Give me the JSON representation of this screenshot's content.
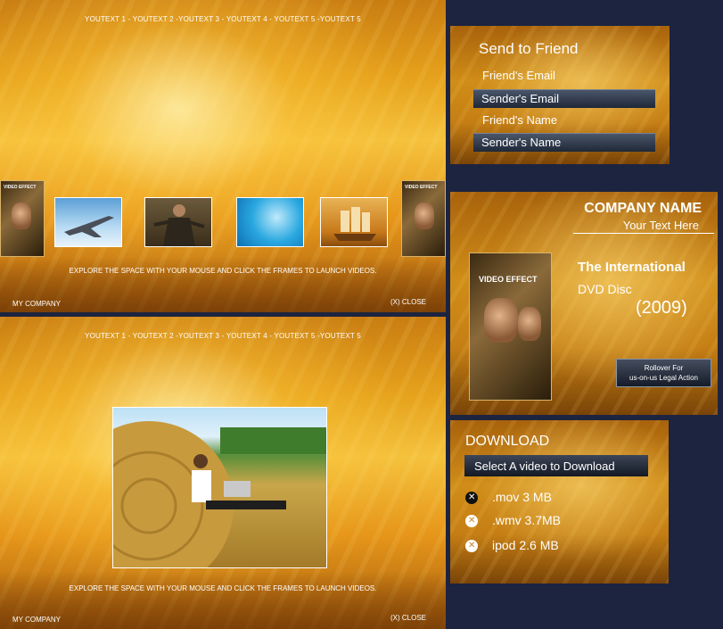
{
  "player_top": {
    "nav": "YOUTEXT 1 - YOUTEXT 2 -YOUTEXT 3 - YOUTEXT 4 - YOUTEXT 5 -YOUTEXT 5",
    "hint": "EXPLORE THE SPACE WITH YOUR MOUSE AND CLICK THE FRAMES TO LAUNCH VIDEOS.",
    "company": "MY COMPANY",
    "close": "(X) CLOSE",
    "dvd_label": "VIDEO EFFECT",
    "thumbnails": [
      "fighter-jet",
      "warrior",
      "blue-water",
      "tall-ship"
    ]
  },
  "player_bottom": {
    "nav": "YOUTEXT 1 - YOUTEXT 2 -YOUTEXT 3 - YOUTEXT 4 - YOUTEXT 5 -YOUTEXT 5",
    "hint": "EXPLORE THE SPACE WITH YOUR MOUSE AND CLICK THE FRAMES TO LAUNCH VIDEOS.",
    "company": "MY COMPANY",
    "close": "(X) CLOSE",
    "video_subject": "man-with-laptop-hay-bale"
  },
  "send_to_friend": {
    "title": "Send to Friend",
    "fields": [
      "Friend's Email",
      "Sender's Email",
      "Friend's Name",
      "Sender's Name"
    ]
  },
  "company_panel": {
    "name": "COMPANY NAME",
    "tagline": "Your Text Here",
    "dvd_label": "VIDEO EFFECT",
    "headline": "The International",
    "disc": "DVD Disc",
    "year": "(2009)",
    "rollover_line1": "Rollover For",
    "rollover_line2": "us-on-us Legal Action"
  },
  "download": {
    "title": "DOWNLOAD",
    "select_label": "Select A video to Download",
    "options": [
      ".mov 3 MB",
      ".wmv 3.7MB",
      "ipod 2.6 MB"
    ]
  },
  "colors": {
    "background": "#1c2440",
    "gold": "#e6a21c",
    "bar_dark": "#1f2838"
  }
}
